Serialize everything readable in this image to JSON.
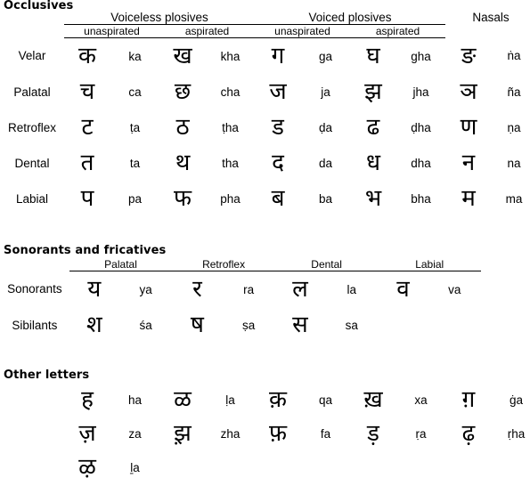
{
  "sections": {
    "occlusives": {
      "title": "Occlusives",
      "group_headers": [
        {
          "label": "Voiceless plosives"
        },
        {
          "label": "Voiced plosives"
        },
        {
          "label": "Nasals"
        }
      ],
      "sub_headers": [
        {
          "label": "unaspirated"
        },
        {
          "label": "aspirated"
        },
        {
          "label": "unaspirated"
        },
        {
          "label": "aspirated"
        }
      ],
      "rows": [
        {
          "label": "Velar",
          "cells": [
            {
              "glyph": "क",
              "roman": "ka"
            },
            {
              "glyph": "ख",
              "roman": "kha"
            },
            {
              "glyph": "ग",
              "roman": "ga"
            },
            {
              "glyph": "घ",
              "roman": "gha"
            },
            {
              "glyph": "ङ",
              "roman": "ṅa"
            }
          ]
        },
        {
          "label": "Palatal",
          "cells": [
            {
              "glyph": "च",
              "roman": "ca"
            },
            {
              "glyph": "छ",
              "roman": "cha"
            },
            {
              "glyph": "ज",
              "roman": "ja"
            },
            {
              "glyph": "झ",
              "roman": "jha"
            },
            {
              "glyph": "ञ",
              "roman": "ña"
            }
          ]
        },
        {
          "label": "Retroflex",
          "cells": [
            {
              "glyph": "ट",
              "roman": "ṭa"
            },
            {
              "glyph": "ठ",
              "roman": "ṭha"
            },
            {
              "glyph": "ड",
              "roman": "ḍa"
            },
            {
              "glyph": "ढ",
              "roman": "ḍha"
            },
            {
              "glyph": "ण",
              "roman": "ṇa"
            }
          ]
        },
        {
          "label": "Dental",
          "cells": [
            {
              "glyph": "त",
              "roman": "ta"
            },
            {
              "glyph": "थ",
              "roman": "tha"
            },
            {
              "glyph": "द",
              "roman": "da"
            },
            {
              "glyph": "ध",
              "roman": "dha"
            },
            {
              "glyph": "न",
              "roman": "na"
            }
          ]
        },
        {
          "label": "Labial",
          "cells": [
            {
              "glyph": "प",
              "roman": "pa"
            },
            {
              "glyph": "फ",
              "roman": "pha"
            },
            {
              "glyph": "ब",
              "roman": "ba"
            },
            {
              "glyph": "भ",
              "roman": "bha"
            },
            {
              "glyph": "म",
              "roman": "ma"
            }
          ]
        }
      ]
    },
    "sonorants": {
      "title": "Sonorants and fricatives",
      "column_headers": [
        {
          "label": "Palatal"
        },
        {
          "label": "Retroflex"
        },
        {
          "label": "Dental"
        },
        {
          "label": "Labial"
        }
      ],
      "rows": [
        {
          "label": "Sonorants",
          "cells": [
            {
              "glyph": "य",
              "roman": "ya"
            },
            {
              "glyph": "र",
              "roman": "ra"
            },
            {
              "glyph": "ल",
              "roman": "la"
            },
            {
              "glyph": "व",
              "roman": "va"
            }
          ]
        },
        {
          "label": "Sibilants",
          "cells": [
            {
              "glyph": "श",
              "roman": "śa"
            },
            {
              "glyph": "ष",
              "roman": "ṣa"
            },
            {
              "glyph": "स",
              "roman": "sa"
            },
            {
              "glyph": "",
              "roman": ""
            }
          ]
        }
      ]
    },
    "other": {
      "title": "Other letters",
      "rows": [
        {
          "label": "",
          "cells": [
            {
              "glyph": "ह",
              "roman": "ha"
            },
            {
              "glyph": "ळ",
              "roman": "ḷa"
            },
            {
              "glyph": "क़",
              "roman": "qa"
            },
            {
              "glyph": "ख़",
              "roman": "xa"
            },
            {
              "glyph": "ग़",
              "roman": "ġa"
            }
          ]
        },
        {
          "label": "",
          "cells": [
            {
              "glyph": "ज़",
              "roman": "za"
            },
            {
              "glyph": "झ़",
              "roman": "zha"
            },
            {
              "glyph": "फ़",
              "roman": "fa"
            },
            {
              "glyph": "ड़",
              "roman": "ṛa"
            },
            {
              "glyph": "ढ़",
              "roman": "ṛha"
            }
          ]
        },
        {
          "label": "",
          "cells": [
            {
              "glyph": "ऴ",
              "roman": "ḻa"
            },
            {
              "glyph": "",
              "roman": ""
            },
            {
              "glyph": "",
              "roman": ""
            },
            {
              "glyph": "",
              "roman": ""
            },
            {
              "glyph": "",
              "roman": ""
            }
          ]
        }
      ]
    }
  }
}
